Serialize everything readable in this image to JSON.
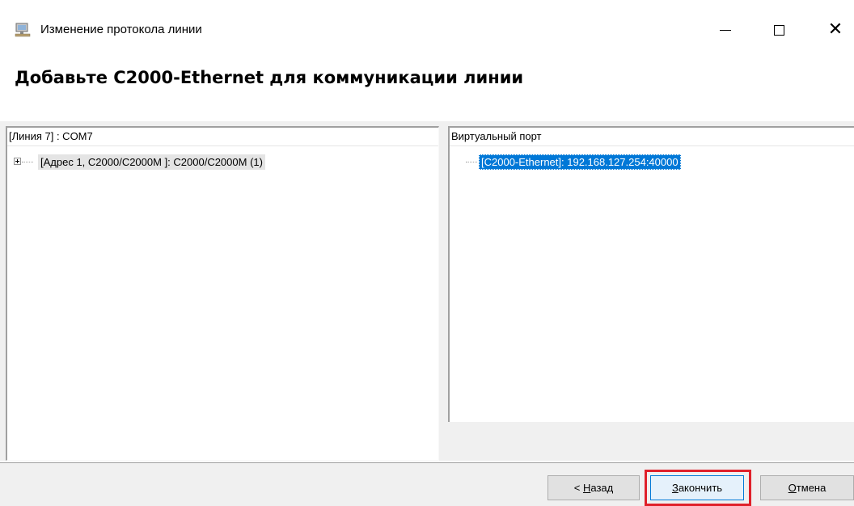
{
  "window": {
    "title": "Изменение протокола линии",
    "title_icon": "network-monitor-icon",
    "controls": [
      "minimize",
      "maximize",
      "close"
    ]
  },
  "heading": "Добавьте С2000-Ethernet для коммуникации линии",
  "left_panel": {
    "header": "[Линия 7] : COM7",
    "items": [
      {
        "label": "[Адрес 1, С2000/С2000М ]: С2000/С2000М (1)",
        "expandable": true,
        "state": "selected-inactive"
      }
    ]
  },
  "right_panel": {
    "header": "Виртуальный порт",
    "items": [
      {
        "label": "[С2000-Ethernet]: 192.168.127.254:40000",
        "expandable": false,
        "state": "selected"
      }
    ]
  },
  "buttons": {
    "back": {
      "prefix": "< ",
      "accel": "Н",
      "rest": "азад"
    },
    "finish": {
      "accel": "З",
      "rest": "акончить"
    },
    "cancel": {
      "accel": "О",
      "rest": "тмена"
    }
  },
  "colors": {
    "selection": "#0078d7",
    "highlight_frame": "#e0202a"
  }
}
